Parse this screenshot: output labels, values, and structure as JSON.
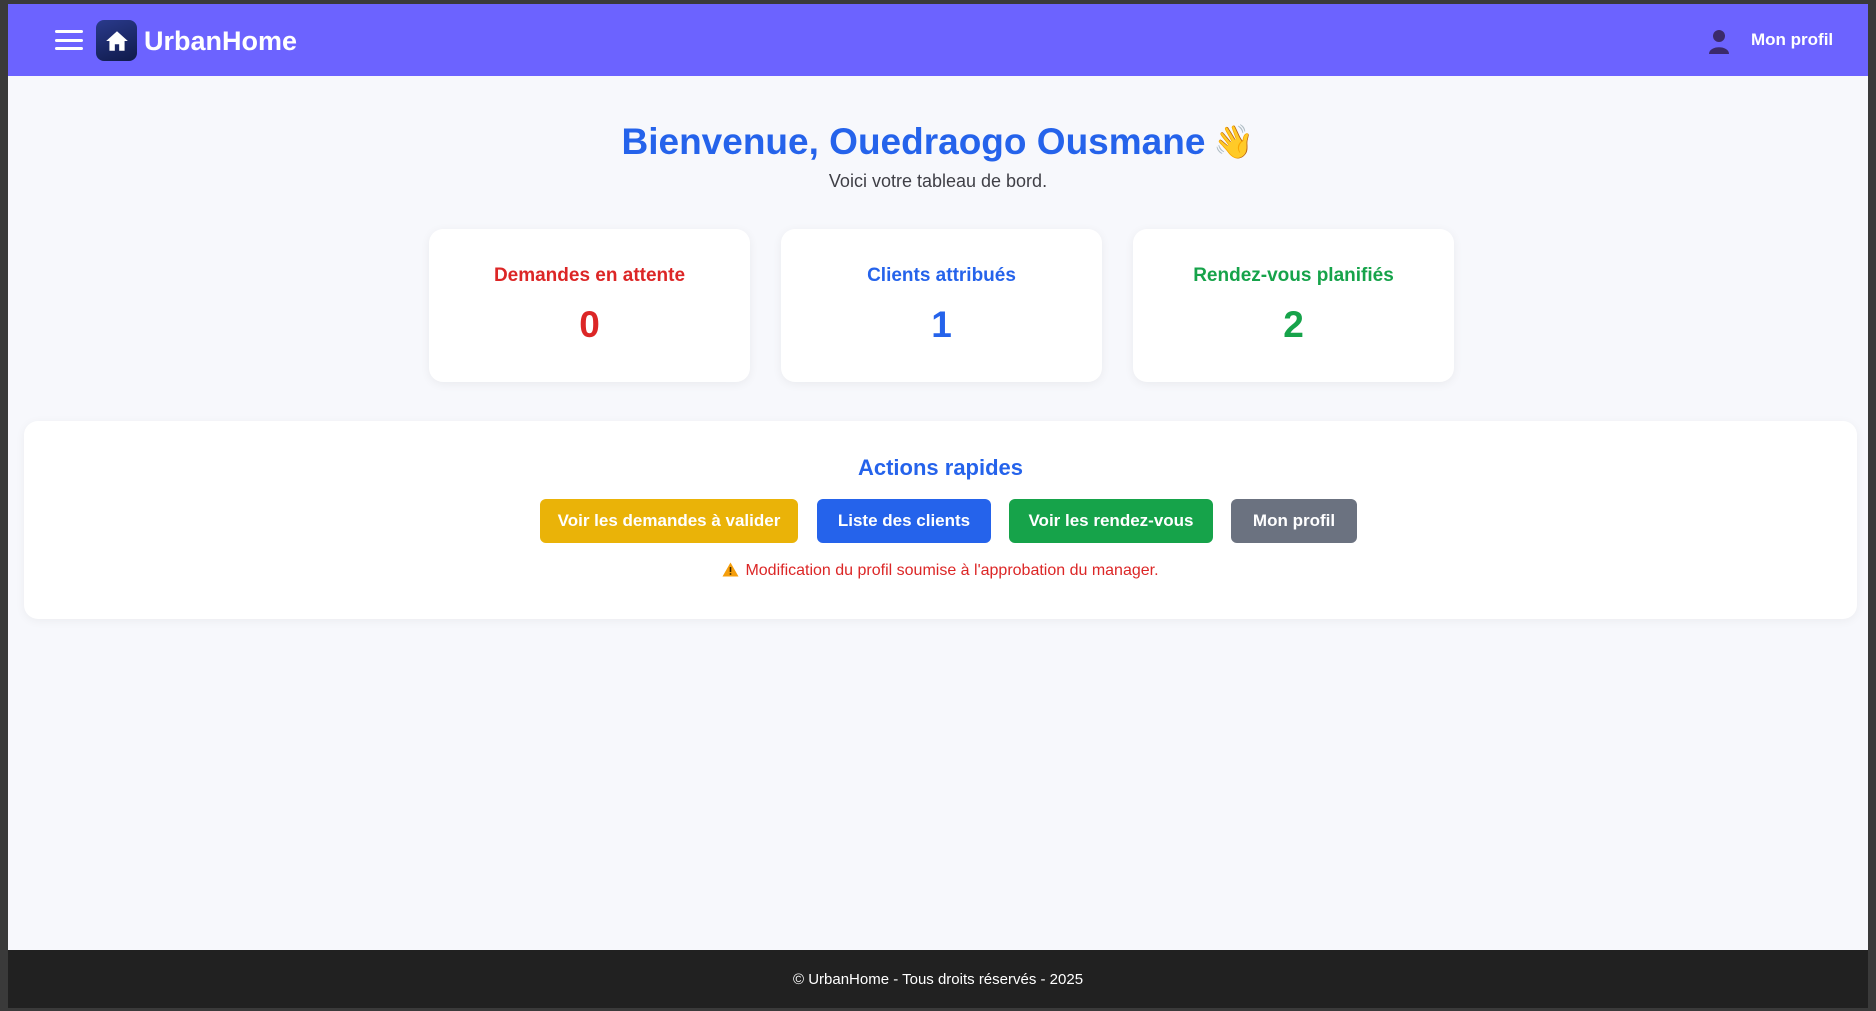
{
  "header": {
    "brand": "UrbanHome",
    "profile_label": "Mon profil",
    "color": "#6c63ff",
    "icons": [
      "hamburger-icon",
      "home-icon",
      "user-icon"
    ]
  },
  "welcome": {
    "title": "Bienvenue, Ouedraogo Ousmane",
    "emoji": "👋",
    "subtitle": "Voici votre tableau de bord."
  },
  "stats": [
    {
      "label": "Demandes en attente",
      "value": "0",
      "color": "#dc2626"
    },
    {
      "label": "Clients attribués",
      "value": "1",
      "color": "#2563eb"
    },
    {
      "label": "Rendez-vous planifiés",
      "value": "2",
      "color": "#16a34a"
    }
  ],
  "actions": {
    "title": "Actions rapides",
    "buttons": [
      {
        "label": "Voir les demandes à valider",
        "color": "#eab308"
      },
      {
        "label": "Liste des clients",
        "color": "#2563eb"
      },
      {
        "label": "Voir les rendez-vous",
        "color": "#16a34a"
      },
      {
        "label": "Mon profil",
        "color": "#6b7280"
      }
    ],
    "warning": "Modification du profil soumise à l'approbation du manager."
  },
  "footer": {
    "text": "© UrbanHome - Tous droits réservés - 2025"
  }
}
